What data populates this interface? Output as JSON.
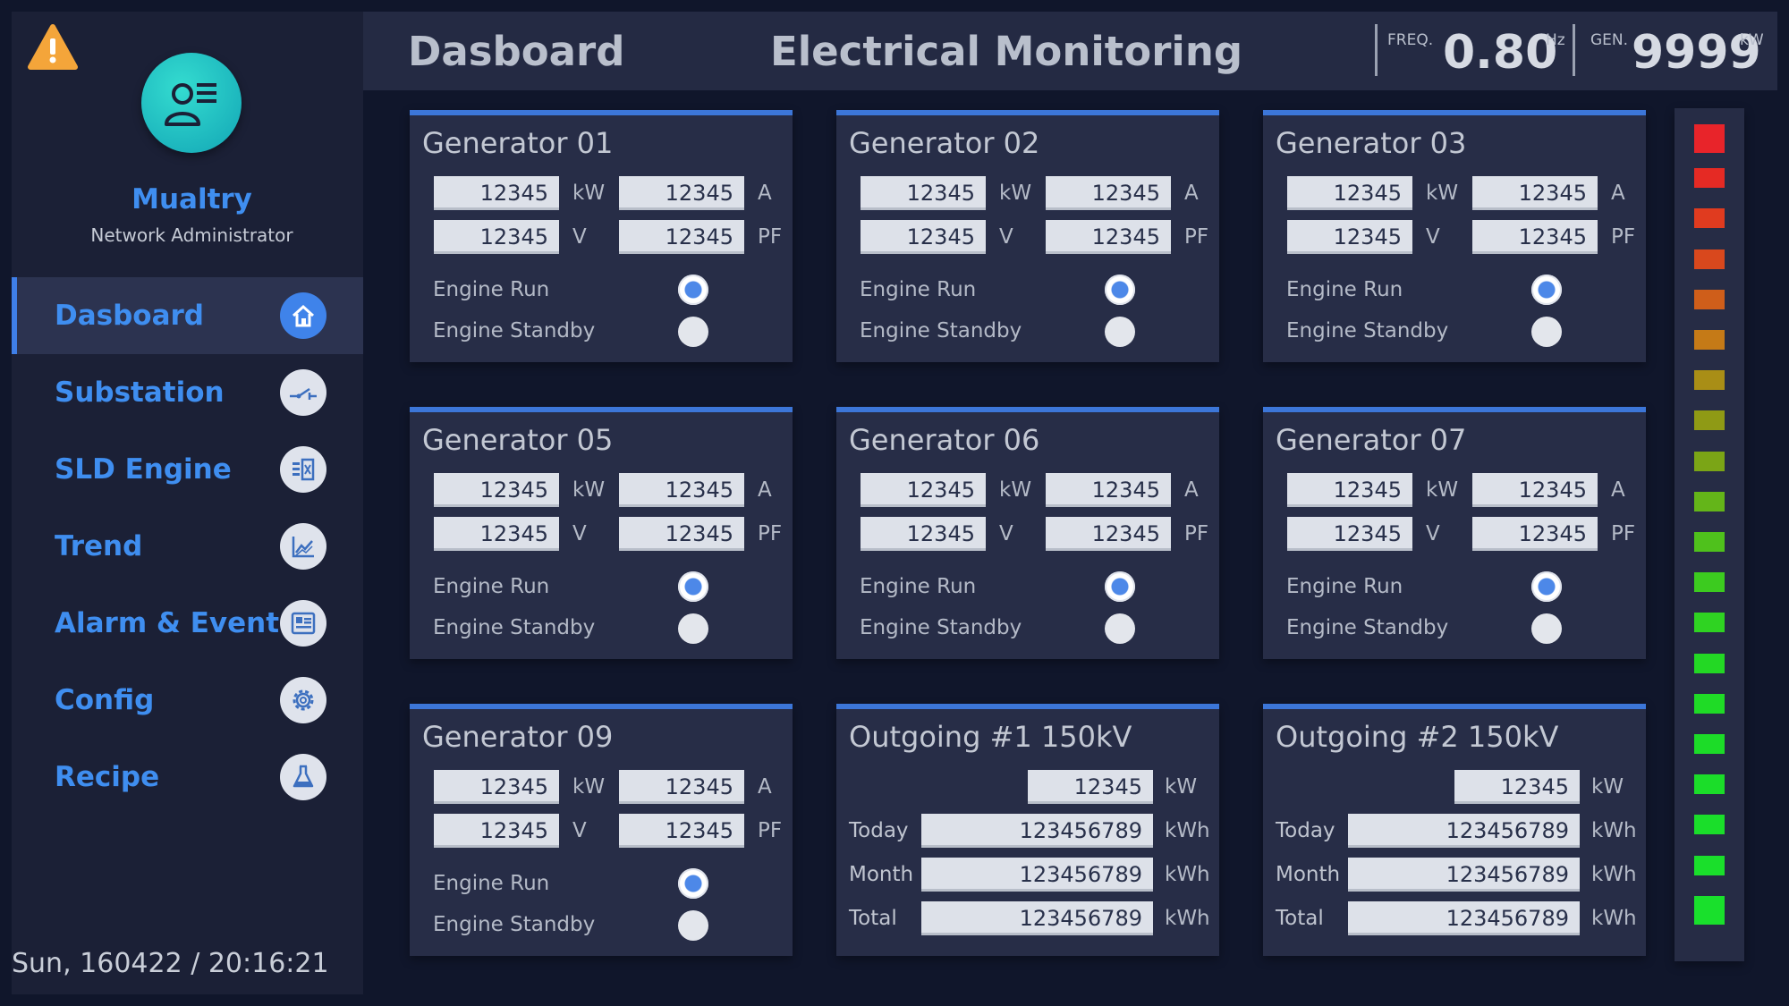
{
  "user": {
    "name": "Mualtry",
    "role": "Network Administrator"
  },
  "nav": [
    {
      "label": "Dasboard",
      "icon": "home-icon",
      "active": true
    },
    {
      "label": "Substation",
      "icon": "switch-icon",
      "active": false
    },
    {
      "label": "SLD Engine",
      "icon": "sld-icon",
      "active": false
    },
    {
      "label": "Trend",
      "icon": "trend-chart-icon",
      "active": false
    },
    {
      "label": "Alarm & Event",
      "icon": "alarm-list-icon",
      "active": false
    },
    {
      "label": "Config",
      "icon": "gear-icon",
      "active": false
    },
    {
      "label": "Recipe",
      "icon": "flask-icon",
      "active": false
    }
  ],
  "datetime": "Sun, 160422 / 20:16:21",
  "header": {
    "page_title": "Dasboard",
    "app_title": "Electrical Monitoring",
    "freq_label": "FREQ.",
    "freq_value": "0.80",
    "freq_unit": "Hz",
    "gen_label": "GEN.",
    "gen_value": "9999",
    "gen_unit": "kW"
  },
  "generators": [
    {
      "title": "Generator 01",
      "kw": "12345",
      "a": "12345",
      "v": "12345",
      "pf": "12345",
      "engine_run": true,
      "engine_standby": false
    },
    {
      "title": "Generator 02",
      "kw": "12345",
      "a": "12345",
      "v": "12345",
      "pf": "12345",
      "engine_run": true,
      "engine_standby": false
    },
    {
      "title": "Generator 03",
      "kw": "12345",
      "a": "12345",
      "v": "12345",
      "pf": "12345",
      "engine_run": true,
      "engine_standby": false
    },
    {
      "title": "Generator 05",
      "kw": "12345",
      "a": "12345",
      "v": "12345",
      "pf": "12345",
      "engine_run": true,
      "engine_standby": false
    },
    {
      "title": "Generator 06",
      "kw": "12345",
      "a": "12345",
      "v": "12345",
      "pf": "12345",
      "engine_run": true,
      "engine_standby": false
    },
    {
      "title": "Generator 07",
      "kw": "12345",
      "a": "12345",
      "v": "12345",
      "pf": "12345",
      "engine_run": true,
      "engine_standby": false
    },
    {
      "title": "Generator 09",
      "kw": "12345",
      "a": "12345",
      "v": "12345",
      "pf": "12345",
      "engine_run": true,
      "engine_standby": false
    }
  ],
  "labels": {
    "kw": "kW",
    "a": "A",
    "v": "V",
    "pf": "PF",
    "kwh": "kWh",
    "engine_run": "Engine Run",
    "engine_standby": "Engine Standby",
    "today": "Today",
    "month": "Month",
    "total": "Total"
  },
  "outgoing": [
    {
      "title": "Outgoing #1 150kV",
      "kw": "12345",
      "today": "123456789",
      "month": "123456789",
      "total": "123456789"
    },
    {
      "title": "Outgoing #2 150kV",
      "kw": "12345",
      "today": "123456789",
      "month": "123456789",
      "total": "123456789"
    }
  ],
  "level_bar": {
    "segments": 20,
    "colors": [
      "#e8242a",
      "#e52a24",
      "#e03b1f",
      "#d9481d",
      "#cf5e1a",
      "#c57a17",
      "#a98e16",
      "#8f9a15",
      "#7ba516",
      "#64b519",
      "#4fc11c",
      "#3ccb1f",
      "#2fd322",
      "#23d824",
      "#1fdb26",
      "#1cdc28",
      "#1bdd29",
      "#1ade2a",
      "#1adf2b",
      "#19e02c"
    ]
  },
  "warning_icon": "warning-triangle-icon",
  "accent_color": "#3f8ef0"
}
